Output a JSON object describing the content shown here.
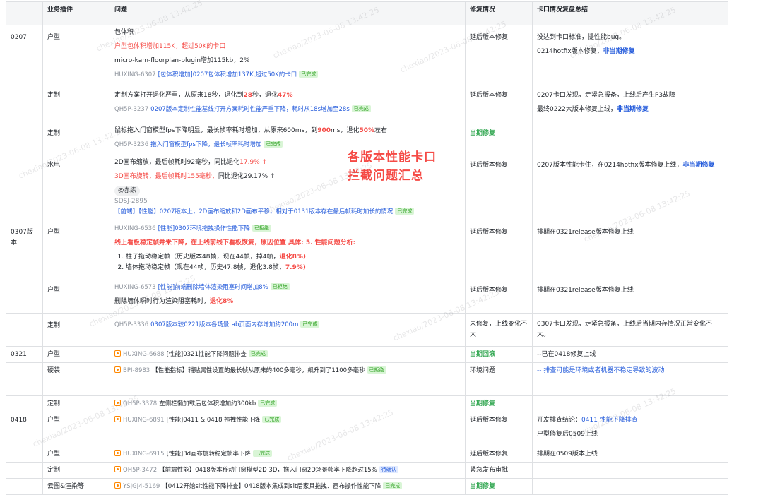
{
  "headers": [
    "",
    "业务插件",
    "问题",
    "修复情况",
    "卡口情况复盘总结"
  ],
  "overlay": {
    "line1": "各版本性能卡口",
    "line2": "拦截问题汇总"
  },
  "watermark": "chexiao/2023-06-08 13:42:25",
  "rows": [
    {
      "version": "0207",
      "biz": "户型",
      "p1": "包体积",
      "p2": "户型包体积增加115K，超过50K的卡口",
      "p3": "micro-kam-floorplan-plugin增加115kb，2%",
      "ticket": {
        "id": "HUXING-6307",
        "title": "[包体积增加]0207包体积增加137K,超过50K的卡口",
        "status": "已完成"
      },
      "fix": "延后版本修复",
      "summary1": "没达到卡口标准，提性能bug。",
      "summary2a": "0214hotfix版本修复，",
      "summary2b": "非当期修复"
    },
    {
      "biz": "定制",
      "p1a": "定制方案打开退化严重，从原来18秒，退化到",
      "p1b": "28",
      "p1c": "秒，退化",
      "p1d": "47%",
      "ticket": {
        "id": "QH5P-3237",
        "title": "0207版本定制性能基线打开方案耗时性能严重下降，耗时从18s增加至28s",
        "status": "已完成"
      },
      "fix": "延后版本修复",
      "summary1": "0207卡口发现，走紧急报备，上线后产生P3故障",
      "summary2a": "最终0222大版本修复上线，",
      "summary2b": "非当期修复"
    },
    {
      "biz": "定制",
      "p1a": "鼠标拖入门窗模型fps下降明显，最长帧率耗时增加，从原来600ms，到",
      "p1b": "900",
      "p1c": "ms，退化",
      "p1d": "50%",
      "p1e": "左右",
      "ticket": {
        "id": "QH5P-3236",
        "title": "拖入门窗模型fps下降，最长帧率耗时增加",
        "status": "已完成"
      },
      "fix": "当期修复"
    },
    {
      "biz": "水电",
      "p1a": "2D画布缩放，最后帧耗时92毫秒，同比退化",
      "p1b": "17.9% ↑",
      "p2a": "3D画布旋转，最后帧耗时155毫秒，",
      "p2b": "同比退化29.17% ↑",
      "mention": "@赤练",
      "ticket_id": "SDSJ-2895",
      "ticket_title": "【前端】【性能】0207版本上，2D画布缩放和2D画布平移，相对于0131版本存在最后帧耗时加长的情况",
      "ticket_status": "已完成",
      "fix": "延后版本修复",
      "summary1": "0207版本性能卡住，在0214hotfix版本修复上线，",
      "summary2": "非当期修复"
    },
    {
      "version": "0307版本",
      "biz": "户型",
      "ticket": {
        "id": "HUXING-6536",
        "title": "[性能]0307环境拖拽操作性能下降",
        "status": "已拒绝"
      },
      "p1": "线上看板稳定帧并未下降，在上线前线下看板恢复，原因位置 具体: 5. 性能问题分析:",
      "li1a": "柱子拖动稳定帧（历史版本48帧，现在44帧，掉4帧，",
      "li1b": "退化8%)",
      "li2a": "墙体拖动稳定帧（现在44帧，历史47.8帧，退化3.8帧，",
      "li2b": "7.9%)",
      "fix": "延后版本修复",
      "summary1": "排期在0321release版本修复上线"
    },
    {
      "biz": "户型",
      "ticket": {
        "id": "HUXING-6573",
        "title": "[性能]前端删除墙体渲染阻塞时间增加8%",
        "status": "已拒绝"
      },
      "p1a": "删除墙体瞬时行为渲染阻塞耗时，",
      "p1b": "退化8%",
      "fix": "延后版本修复",
      "summary1": "排期在0321release版本修复上线"
    },
    {
      "biz": "定制",
      "ticket": {
        "id": "QH5P-3336",
        "title": "0307版本较0221版本各场景tab页面内存增加约200m",
        "status": "已完成"
      },
      "fix": "未修复，上线变化不大",
      "summary1": "0307卡口发现，走紧急报备，上线后当期内存情况正常变化不大。"
    },
    {
      "version": "0321",
      "biz": "户型",
      "ticket": {
        "id": "HUXING-6688",
        "title": "[性能]0321性能下降问题排查",
        "status": "已完成"
      },
      "fix": "当期回滚",
      "summary1": "--已在0418修复上线"
    },
    {
      "biz": "硬装",
      "ticket": {
        "id": "BPI-8983",
        "title": "【性能指标】辅贴属性设置的最长帧从原来的400多毫秒，飙升到了1100多毫秒",
        "status": "已拒绝"
      },
      "fix": "环境问题",
      "summary1": "-- 排查可能是环境或者机器不稳定导致的波动"
    },
    {
      "biz": "定制",
      "ticket": {
        "id": "QH5P-3378",
        "title": "左侧栏懒加载后包体积增加约300kb",
        "status": "已完成"
      },
      "fix": "当期修复"
    },
    {
      "version": "0418",
      "biz": "户型",
      "ticket": {
        "id": "HUXING-6891",
        "title": "[性能]0411 & 0418 拖拽性能下降",
        "status": "已完成"
      },
      "fix": "延后版本修复",
      "summary1a": "开发排查结论：",
      "summary1b": "0411 性能下降排查",
      "summary2": "户型修复后0509上线"
    },
    {
      "biz": "户型",
      "ticket": {
        "id": "HUXING-6915",
        "title": "[性能]3d画布旋转稳定帧率下降",
        "status": "已完成"
      },
      "fix": "延后版本修复",
      "summary1": "排期在0509版本上线"
    },
    {
      "biz": "定制",
      "ticket": {
        "id": "QH5P-3472",
        "title": "【前端性能】0418版本移动门窗模型2D 3D，拖入门窗2D场景帧率下降超过15%",
        "status": "待确认"
      },
      "fix": "紧急发布审批"
    },
    {
      "biz": "云图&渲染等",
      "ticket": {
        "id": "YSJGJ4-5169",
        "title": "【0412开始sit性能下降排查】0418版本集成到sit后家具拖拽、画布操作性能下降",
        "status": "已完成"
      },
      "fix": "当期修复"
    }
  ]
}
